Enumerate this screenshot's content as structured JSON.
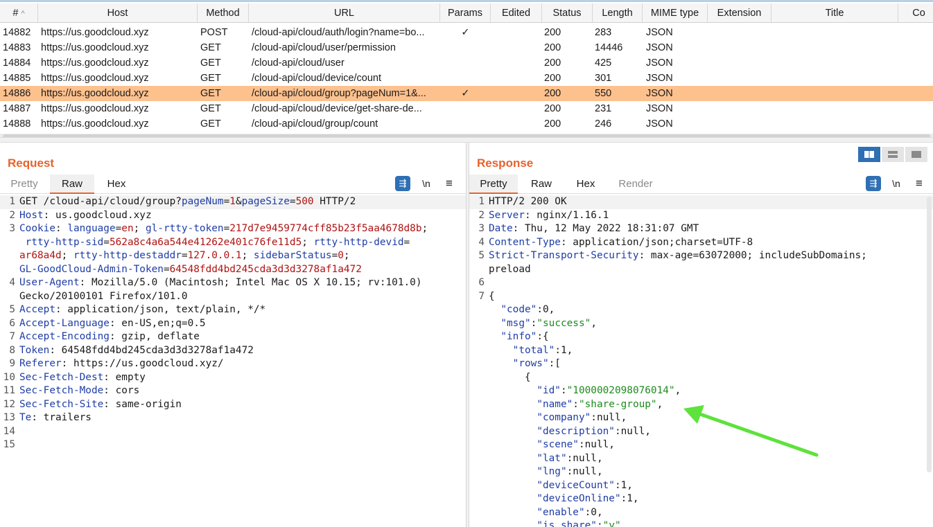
{
  "history": {
    "columns": [
      {
        "key": "num",
        "label": "#"
      },
      {
        "key": "host",
        "label": "Host"
      },
      {
        "key": "method",
        "label": "Method"
      },
      {
        "key": "url",
        "label": "URL"
      },
      {
        "key": "params",
        "label": "Params"
      },
      {
        "key": "edited",
        "label": "Edited"
      },
      {
        "key": "status",
        "label": "Status"
      },
      {
        "key": "length",
        "label": "Length"
      },
      {
        "key": "mime",
        "label": "MIME type"
      },
      {
        "key": "extension",
        "label": "Extension"
      },
      {
        "key": "title",
        "label": "Title"
      },
      {
        "key": "comment",
        "label": "Co"
      }
    ],
    "sort_indicator": "^",
    "rows": [
      {
        "num": "14882",
        "host": "https://us.goodcloud.xyz",
        "method": "POST",
        "url": "/cloud-api/cloud/auth/login?name=bo...",
        "params": "✓",
        "edited": "",
        "status": "200",
        "length": "283",
        "mime": "JSON",
        "extension": "",
        "title": "",
        "selected": false
      },
      {
        "num": "14883",
        "host": "https://us.goodcloud.xyz",
        "method": "GET",
        "url": "/cloud-api/cloud/user/permission",
        "params": "",
        "edited": "",
        "status": "200",
        "length": "14446",
        "mime": "JSON",
        "extension": "",
        "title": "",
        "selected": false
      },
      {
        "num": "14884",
        "host": "https://us.goodcloud.xyz",
        "method": "GET",
        "url": "/cloud-api/cloud/user",
        "params": "",
        "edited": "",
        "status": "200",
        "length": "425",
        "mime": "JSON",
        "extension": "",
        "title": "",
        "selected": false
      },
      {
        "num": "14885",
        "host": "https://us.goodcloud.xyz",
        "method": "GET",
        "url": "/cloud-api/cloud/device/count",
        "params": "",
        "edited": "",
        "status": "200",
        "length": "301",
        "mime": "JSON",
        "extension": "",
        "title": "",
        "selected": false
      },
      {
        "num": "14886",
        "host": "https://us.goodcloud.xyz",
        "method": "GET",
        "url": "/cloud-api/cloud/group?pageNum=1&...",
        "params": "✓",
        "edited": "",
        "status": "200",
        "length": "550",
        "mime": "JSON",
        "extension": "",
        "title": "",
        "selected": true
      },
      {
        "num": "14887",
        "host": "https://us.goodcloud.xyz",
        "method": "GET",
        "url": "/cloud-api/cloud/device/get-share-de...",
        "params": "",
        "edited": "",
        "status": "200",
        "length": "231",
        "mime": "JSON",
        "extension": "",
        "title": "",
        "selected": false
      },
      {
        "num": "14888",
        "host": "https://us.goodcloud.xyz",
        "method": "GET",
        "url": "/cloud-api/cloud/group/count",
        "params": "",
        "edited": "",
        "status": "200",
        "length": "246",
        "mime": "JSON",
        "extension": "",
        "title": "",
        "selected": false
      }
    ]
  },
  "request": {
    "title": "Request",
    "tabs": [
      {
        "label": "Pretty",
        "state": "inactive"
      },
      {
        "label": "Raw",
        "state": "active"
      },
      {
        "label": "Hex",
        "state": "normal"
      }
    ],
    "toolbar": {
      "wrap_icon": "word-wrap-icon",
      "newline_label": "\\n",
      "menu_icon": "hamburger-menu-icon"
    },
    "lines": [
      {
        "n": "1",
        "current": true,
        "parts": [
          [
            "t",
            "GET /cloud-api/cloud/group?"
          ],
          [
            "k",
            "pageNum"
          ],
          [
            "t",
            "="
          ],
          [
            "v",
            "1"
          ],
          [
            "t",
            "&"
          ],
          [
            "k",
            "pageSize"
          ],
          [
            "t",
            "="
          ],
          [
            "v",
            "500"
          ],
          [
            "t",
            " HTTP/2"
          ]
        ]
      },
      {
        "n": "2",
        "parts": [
          [
            "k",
            "Host"
          ],
          [
            "t",
            ": us.goodcloud.xyz"
          ]
        ]
      },
      {
        "n": "3",
        "parts": [
          [
            "k",
            "Cookie"
          ],
          [
            "t",
            ": "
          ],
          [
            "k",
            "language"
          ],
          [
            "t",
            "="
          ],
          [
            "v",
            "en"
          ],
          [
            "t",
            "; "
          ],
          [
            "k",
            "gl-rtty-token"
          ],
          [
            "t",
            "="
          ],
          [
            "v",
            "217d7e9459774cff85b23f5aa4678d8b"
          ],
          [
            "t",
            ";"
          ]
        ]
      },
      {
        "n": "",
        "parts": [
          [
            "t",
            " "
          ],
          [
            "k",
            "rtty-http-sid"
          ],
          [
            "t",
            "="
          ],
          [
            "v",
            "562a8c4a6a544e41262e401c76fe11d5"
          ],
          [
            "t",
            "; "
          ],
          [
            "k",
            "rtty-http-devid"
          ],
          [
            "t",
            "="
          ]
        ]
      },
      {
        "n": "",
        "parts": [
          [
            "v",
            "ar68a4d"
          ],
          [
            "t",
            "; "
          ],
          [
            "k",
            "rtty-http-destaddr"
          ],
          [
            "t",
            "="
          ],
          [
            "v",
            "127.0.0.1"
          ],
          [
            "t",
            "; "
          ],
          [
            "k",
            "sidebarStatus"
          ],
          [
            "t",
            "="
          ],
          [
            "v",
            "0"
          ],
          [
            "t",
            ";"
          ]
        ]
      },
      {
        "n": "",
        "parts": [
          [
            "k",
            "GL-GoodCloud-Admin-Token"
          ],
          [
            "t",
            "="
          ],
          [
            "v",
            "64548fdd4bd245cda3d3d3278af1a472"
          ]
        ]
      },
      {
        "n": "4",
        "parts": [
          [
            "k",
            "User-Agent"
          ],
          [
            "t",
            ": Mozilla/5.0 (Macintosh; Intel Mac OS X 10.15; rv:101.0)"
          ]
        ]
      },
      {
        "n": "",
        "parts": [
          [
            "t",
            "Gecko/20100101 Firefox/101.0"
          ]
        ]
      },
      {
        "n": "5",
        "parts": [
          [
            "k",
            "Accept"
          ],
          [
            "t",
            ": application/json, text/plain, */*"
          ]
        ]
      },
      {
        "n": "6",
        "parts": [
          [
            "k",
            "Accept-Language"
          ],
          [
            "t",
            ": en-US,en;q=0.5"
          ]
        ]
      },
      {
        "n": "7",
        "parts": [
          [
            "k",
            "Accept-Encoding"
          ],
          [
            "t",
            ": gzip, deflate"
          ]
        ]
      },
      {
        "n": "8",
        "parts": [
          [
            "k",
            "Token"
          ],
          [
            "t",
            ": 64548fdd4bd245cda3d3d3278af1a472"
          ]
        ]
      },
      {
        "n": "9",
        "parts": [
          [
            "k",
            "Referer"
          ],
          [
            "t",
            ": https://us.goodcloud.xyz/"
          ]
        ]
      },
      {
        "n": "10",
        "parts": [
          [
            "k",
            "Sec-Fetch-Dest"
          ],
          [
            "t",
            ": empty"
          ]
        ]
      },
      {
        "n": "11",
        "parts": [
          [
            "k",
            "Sec-Fetch-Mode"
          ],
          [
            "t",
            ": cors"
          ]
        ]
      },
      {
        "n": "12",
        "parts": [
          [
            "k",
            "Sec-Fetch-Site"
          ],
          [
            "t",
            ": same-origin"
          ]
        ]
      },
      {
        "n": "13",
        "parts": [
          [
            "k",
            "Te"
          ],
          [
            "t",
            ": trailers"
          ]
        ]
      },
      {
        "n": "14",
        "parts": []
      },
      {
        "n": "15",
        "parts": []
      }
    ]
  },
  "response": {
    "title": "Response",
    "tabs": [
      {
        "label": "Pretty",
        "state": "active"
      },
      {
        "label": "Raw",
        "state": "normal"
      },
      {
        "label": "Hex",
        "state": "normal"
      },
      {
        "label": "Render",
        "state": "inactive"
      }
    ],
    "toolbar": {
      "wrap_icon": "word-wrap-icon",
      "newline_label": "\\n",
      "menu_icon": "hamburger-menu-icon"
    },
    "lines": [
      {
        "n": "1",
        "current": true,
        "parts": [
          [
            "t",
            "HTTP/2 200 OK"
          ]
        ]
      },
      {
        "n": "2",
        "parts": [
          [
            "k",
            "Server"
          ],
          [
            "t",
            ": nginx/1.16.1"
          ]
        ]
      },
      {
        "n": "3",
        "parts": [
          [
            "k",
            "Date"
          ],
          [
            "t",
            ": Thu, 12 May 2022 18:31:07 GMT"
          ]
        ]
      },
      {
        "n": "4",
        "parts": [
          [
            "k",
            "Content-Type"
          ],
          [
            "t",
            ": application/json;charset=UTF-8"
          ]
        ]
      },
      {
        "n": "5",
        "parts": [
          [
            "k",
            "Strict-Transport-Security"
          ],
          [
            "t",
            ": max-age=63072000; includeSubDomains;"
          ]
        ]
      },
      {
        "n": "",
        "parts": [
          [
            "t",
            "preload"
          ]
        ]
      },
      {
        "n": "6",
        "parts": []
      },
      {
        "n": "7",
        "parts": [
          [
            "t",
            "{"
          ]
        ]
      },
      {
        "n": "",
        "parts": [
          [
            "t",
            "  "
          ],
          [
            "k",
            "\"code\""
          ],
          [
            "t",
            ":0,"
          ]
        ]
      },
      {
        "n": "",
        "parts": [
          [
            "t",
            "  "
          ],
          [
            "k",
            "\"msg\""
          ],
          [
            "t",
            ":"
          ],
          [
            "s",
            "\"success\""
          ],
          [
            "t",
            ","
          ]
        ]
      },
      {
        "n": "",
        "parts": [
          [
            "t",
            "  "
          ],
          [
            "k",
            "\"info\""
          ],
          [
            "t",
            ":{"
          ]
        ]
      },
      {
        "n": "",
        "parts": [
          [
            "t",
            "    "
          ],
          [
            "k",
            "\"total\""
          ],
          [
            "t",
            ":1,"
          ]
        ]
      },
      {
        "n": "",
        "parts": [
          [
            "t",
            "    "
          ],
          [
            "k",
            "\"rows\""
          ],
          [
            "t",
            ":["
          ]
        ]
      },
      {
        "n": "",
        "parts": [
          [
            "t",
            "      {"
          ]
        ]
      },
      {
        "n": "",
        "parts": [
          [
            "t",
            "        "
          ],
          [
            "k",
            "\"id\""
          ],
          [
            "t",
            ":"
          ],
          [
            "s",
            "\"1000002098076014\""
          ],
          [
            "t",
            ","
          ]
        ]
      },
      {
        "n": "",
        "parts": [
          [
            "t",
            "        "
          ],
          [
            "k",
            "\"name\""
          ],
          [
            "t",
            ":"
          ],
          [
            "s",
            "\"share-group\""
          ],
          [
            "t",
            ","
          ]
        ]
      },
      {
        "n": "",
        "parts": [
          [
            "t",
            "        "
          ],
          [
            "k",
            "\"company\""
          ],
          [
            "t",
            ":null,"
          ]
        ]
      },
      {
        "n": "",
        "parts": [
          [
            "t",
            "        "
          ],
          [
            "k",
            "\"description\""
          ],
          [
            "t",
            ":null,"
          ]
        ]
      },
      {
        "n": "",
        "parts": [
          [
            "t",
            "        "
          ],
          [
            "k",
            "\"scene\""
          ],
          [
            "t",
            ":null,"
          ]
        ]
      },
      {
        "n": "",
        "parts": [
          [
            "t",
            "        "
          ],
          [
            "k",
            "\"lat\""
          ],
          [
            "t",
            ":null,"
          ]
        ]
      },
      {
        "n": "",
        "parts": [
          [
            "t",
            "        "
          ],
          [
            "k",
            "\"lng\""
          ],
          [
            "t",
            ":null,"
          ]
        ]
      },
      {
        "n": "",
        "parts": [
          [
            "t",
            "        "
          ],
          [
            "k",
            "\"deviceCount\""
          ],
          [
            "t",
            ":1,"
          ]
        ]
      },
      {
        "n": "",
        "parts": [
          [
            "t",
            "        "
          ],
          [
            "k",
            "\"deviceOnline\""
          ],
          [
            "t",
            ":1,"
          ]
        ]
      },
      {
        "n": "",
        "parts": [
          [
            "t",
            "        "
          ],
          [
            "k",
            "\"enable\""
          ],
          [
            "t",
            ":0,"
          ]
        ]
      },
      {
        "n": "",
        "parts": [
          [
            "t",
            "        "
          ],
          [
            "k",
            "\"is_share\""
          ],
          [
            "t",
            ":"
          ],
          [
            "s",
            "\"y\""
          ]
        ]
      }
    ]
  },
  "layout_toggles": [
    {
      "icon": "split-columns-icon",
      "active": true
    },
    {
      "icon": "split-rows-icon",
      "active": false
    },
    {
      "icon": "tabs-layout-icon",
      "active": false
    }
  ],
  "annotation": {
    "icon": "green-arrow-icon",
    "color": "#5ee23c"
  },
  "colors": {
    "accent": "#e8622b",
    "selected_row": "#fdc18e",
    "key": "#1f3da5",
    "value": "#b01212",
    "string": "#1d8a1d",
    "button_blue": "#2f6fb4"
  }
}
